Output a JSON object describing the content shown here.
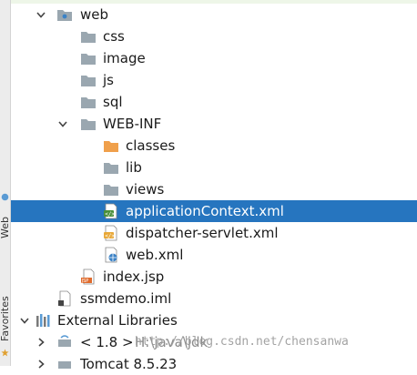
{
  "side_tabs": {
    "web": "Web",
    "favorites": "Favorites"
  },
  "tree": {
    "web": "web",
    "css": "css",
    "image": "image",
    "js": "js",
    "sql": "sql",
    "webinf": "WEB-INF",
    "classes": "classes",
    "lib": "lib",
    "views": "views",
    "app_context": "applicationContext.xml",
    "dispatcher": "dispatcher-servlet.xml",
    "webxml": "web.xml",
    "index_jsp": "index.jsp",
    "ssmdemo_iml": "ssmdemo.iml",
    "external_libraries": "External Libraries",
    "jdk_label": "< 1.8 >",
    "jdk_path": "H:\\java\\jdk",
    "tomcat": "Tomcat 8.5.23"
  },
  "watermark": "http://blog.csdn.net/chensanwa",
  "colors": {
    "selection": "#2675bf",
    "folder": "#9aa7b0",
    "folder_orange": "#f0a04b",
    "xml_icon": "#4a8f3a"
  }
}
